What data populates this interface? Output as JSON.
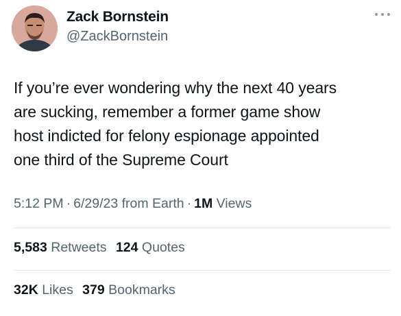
{
  "author": {
    "name": "Zack Bornstein",
    "handle": "@ZackBornstein",
    "avatar_icon": "profile-photo-icon"
  },
  "more_icon": "more-options-icon",
  "tweet": {
    "lines": [
      "If you’re ever wondering why the next 40 years",
      "are sucking, remember a former game show",
      "host indicted for felony espionage appointed",
      "one third of the Supreme Court"
    ]
  },
  "meta": {
    "time": "5:12 PM",
    "date": "6/29/23",
    "source": "from Earth",
    "views_count": "1M",
    "views_label": "Views",
    "separator": "·"
  },
  "stats": {
    "retweets_count": "5,583",
    "retweets_label": "Retweets",
    "quotes_count": "124",
    "quotes_label": "Quotes",
    "likes_count": "32K",
    "likes_label": "Likes",
    "bookmarks_count": "379",
    "bookmarks_label": "Bookmarks"
  },
  "colors": {
    "text_primary": "#0f1419",
    "text_secondary": "#536471",
    "divider": "#e3e6e8"
  }
}
